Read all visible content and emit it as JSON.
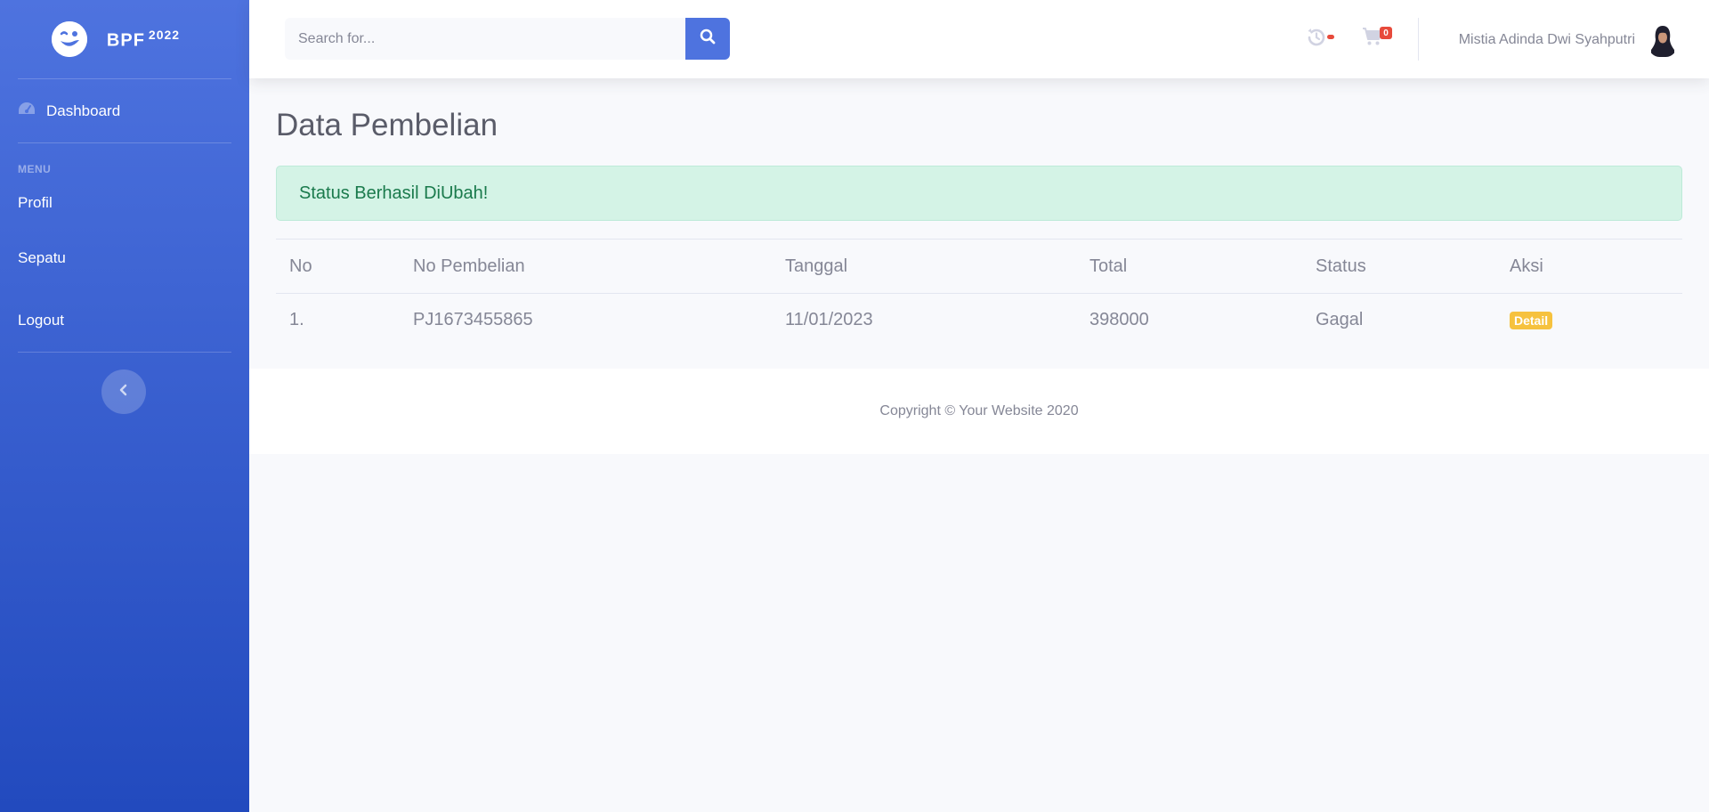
{
  "brand": {
    "name": "BPF",
    "year": "2022",
    "icon": "wink-face-icon"
  },
  "sidebar": {
    "dashboard": {
      "label": "Dashboard",
      "icon": "tachometer-icon"
    },
    "heading": "MENU",
    "items": [
      {
        "label": "Profil"
      },
      {
        "label": "Sepatu"
      },
      {
        "label": "Logout"
      }
    ],
    "toggle_icon": "chevron-left-icon"
  },
  "topbar": {
    "search": {
      "placeholder": "Search for...",
      "value": ""
    },
    "cart_count": "0",
    "user_name": "Mistia Adinda Dwi Syahputri"
  },
  "page": {
    "title": "Data Pembelian",
    "alert": "Status Berhasil DiUbah!"
  },
  "table": {
    "headers": [
      "No",
      "No Pembelian",
      "Tanggal",
      "Total",
      "Status",
      "Aksi"
    ],
    "rows": [
      {
        "no": "1.",
        "no_pembelian": "PJ1673455865",
        "tanggal": "11/01/2023",
        "total": "398000",
        "status": "Gagal",
        "aksi": "Detail"
      }
    ]
  },
  "footer": {
    "text": "Copyright © Your Website 2020"
  },
  "colors": {
    "primary": "#4e73df",
    "sidebar_dark": "#224abe",
    "alert_bg": "#d4f3e6",
    "badge_warning": "#f6c23e",
    "badge_danger": "#e74a3b"
  }
}
